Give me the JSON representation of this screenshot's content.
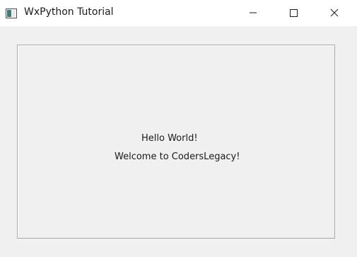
{
  "window": {
    "title": "WxPython Tutorial",
    "icon": "window-app-icon",
    "controls": {
      "minimize": "minimize-icon",
      "maximize": "maximize-icon",
      "close": "close-icon"
    }
  },
  "content": {
    "line1": "Hello World!",
    "line2": "Welcome to CodersLegacy!"
  },
  "colors": {
    "titlebar_bg": "#ffffff",
    "client_bg": "#f0f0f0",
    "border": "#a9a9a9",
    "text": "#1a1a1a"
  }
}
